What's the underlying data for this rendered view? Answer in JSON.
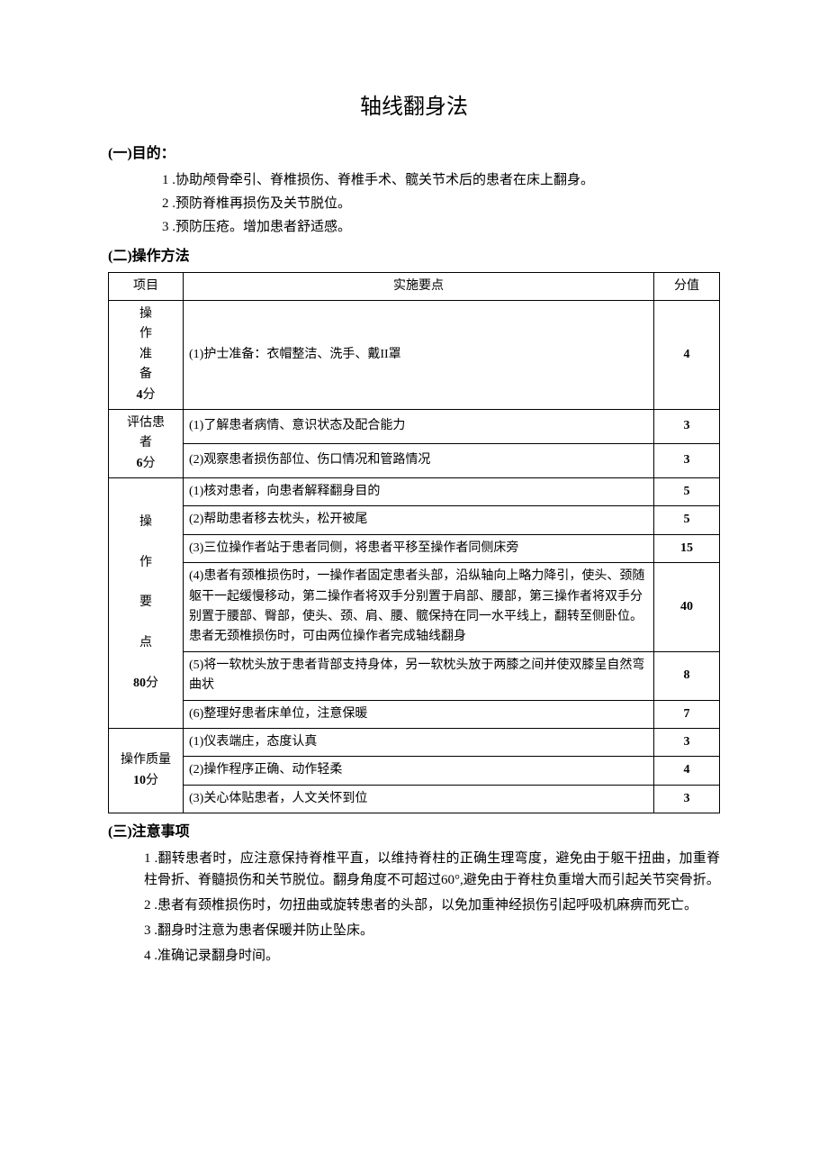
{
  "title": "轴线翻身法",
  "sections": {
    "purpose": {
      "heading": "(一)目的：",
      "items": [
        "1 .协助颅骨牵引、脊椎损伤、脊椎手术、髋关节术后的患者在床上翻身。",
        "2 .预防脊椎再损伤及关节脱位。",
        "3 .预防压疮。增加患者舒适感。"
      ]
    },
    "method": {
      "heading": "(二)操作方法",
      "table": {
        "headers": [
          "项目",
          "实施要点",
          "分值"
        ],
        "rows": [
          {
            "item": "操作准备4分",
            "point": "(1)护士准备：衣帽整洁、洗手、戴II罩",
            "score": "4"
          },
          {
            "item_rowspan": 2,
            "item": "评估患者6分",
            "point": "(1)了解患者病情、意识状态及配合能力",
            "score": "3"
          },
          {
            "point": "(2)观察患者损伤部位、伤口情况和管路情况",
            "score": "3"
          },
          {
            "item_rowspan": 6,
            "item": "操\n\n作\n\n要\n\n点\n\n80分",
            "point": "(1)核对患者，向患者解释翻身目的",
            "score": "5"
          },
          {
            "point": "(2)帮助患者移去枕头，松开被尾",
            "score": "5"
          },
          {
            "point": "(3)三位操作者站于患者同侧，将患者平移至操作者同侧床旁",
            "score": "15"
          },
          {
            "point": "(4)患者有颈椎损伤时，一操作者固定患者头部，沿纵轴向上略力降引，使头、颈随躯干一起缓慢移动，第二操作者将双手分别置于肩部、腰部，第三操作者将双手分别置于腰部、臀部，使头、颈、肩、腰、髋保持在同一水平线上，翻转至侧卧位。患者无颈椎损伤时，可由两位操作者完成轴线翻身",
            "score": "40"
          },
          {
            "point": "(5)将一软枕头放于患者背部支持身体，另一软枕头放于两膝之间并使双膝呈自然弯曲状",
            "score": "8"
          },
          {
            "point": "(6)整理好患者床单位，注意保暖",
            "score": "7"
          },
          {
            "item_rowspan": 3,
            "item": "操作质量10分",
            "point": "(1)仪表端庄，态度认真",
            "score": "3"
          },
          {
            "point": "(2)操作程序正确、动作轻柔",
            "score": "4"
          },
          {
            "point": "(3)关心体贴患者，人文关怀到位",
            "score": "3"
          }
        ]
      }
    },
    "notes": {
      "heading": "(三)注意事项",
      "items": [
        "1 .翻转患者时，应注意保持脊椎平直，以维持脊柱的正确生理弯度，避免由于躯干扭曲，加重脊柱骨折、脊髓损伤和关节脱位。翻身角度不可超过60°,避免由于脊柱负重增大而引起关节突骨折。",
        "2 .患者有颈椎损伤时，勿扭曲或旋转患者的头部，以免加重神经损伤引起呼吸机麻痹而死亡。",
        "3 .翻身时注意为患者保暖并防止坠床。",
        "4 .准确记录翻身时间。"
      ]
    }
  }
}
